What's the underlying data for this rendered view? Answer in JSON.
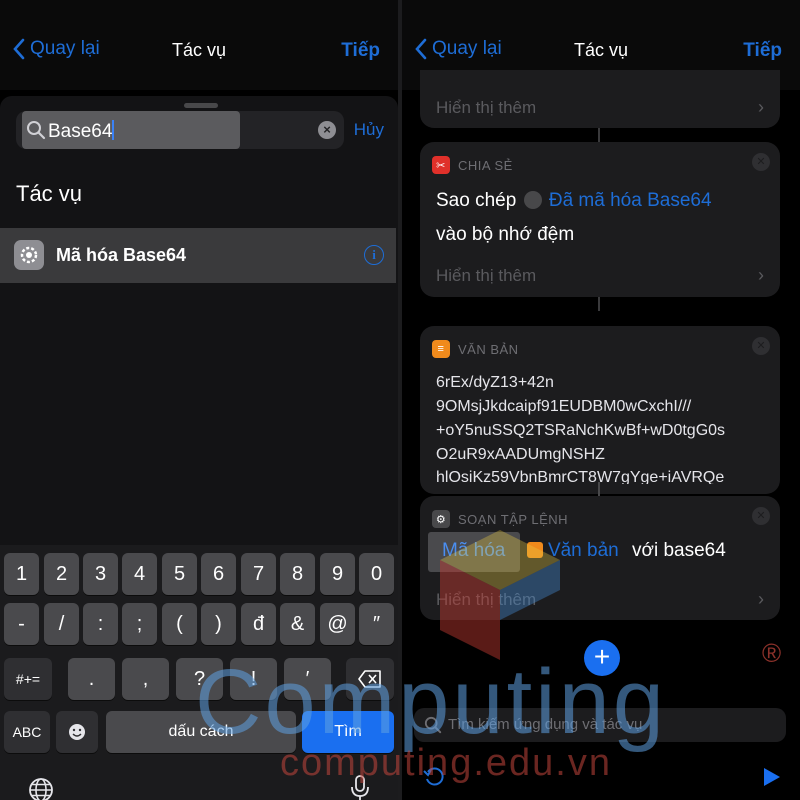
{
  "left": {
    "nav": {
      "back_label": "Quay lại",
      "title": "Tác vụ",
      "next_label": "Tiếp"
    },
    "search": {
      "query": "Base64",
      "cancel_label": "Hủy"
    },
    "section_title": "Tác vụ",
    "result": {
      "label": "Mã hóa Base64"
    },
    "keyboard": {
      "row1": [
        "1",
        "2",
        "3",
        "4",
        "5",
        "6",
        "7",
        "8",
        "9",
        "0"
      ],
      "row2": [
        "-",
        "/",
        ":",
        ";",
        "(",
        ")",
        "đ",
        "&",
        "@",
        "″"
      ],
      "row3_mode": "#+=",
      "row3": [
        ".",
        ",",
        "?",
        "!",
        "′"
      ],
      "abc_label": "ABC",
      "space_label": "dấu cách",
      "go_label": "Tìm"
    }
  },
  "right": {
    "nav": {
      "back_label": "Quay lại",
      "title": "Tác vụ",
      "next_label": "Tiếp"
    },
    "show_more_label": "Hiển thị thêm",
    "share_card": {
      "category": "CHIA SẺ",
      "verb": "Sao chép",
      "variable": "Đã mã hóa Base64",
      "tail": "vào bộ nhớ đệm"
    },
    "text_card": {
      "category": "VĂN BẢN",
      "lines": [
        "6rEx/dyZ13+42n",
        "9OMsjJkdcaipf91EUDBM0wCxchI///",
        "+oY5nuSSQ2TSRaNchKwBf+wD0tgG0s",
        "O2uR9xAADUmgNSHZ",
        "hlOsiKz59VbnBmrCT8W7gYge+iAVRQe"
      ]
    },
    "script_card": {
      "category": "SOẠN TẬP LỆNH",
      "action": "Mã hóa",
      "variable": "Văn bản",
      "tail": "với base64"
    },
    "add_label": "+",
    "bottom_search_placeholder": "Tìm kiếm ứng dụng và tác vụ"
  },
  "watermark": {
    "brand": "Computing",
    "url": "computing.edu.vn",
    "reg": "®"
  },
  "colors": {
    "accent": "#1e6dd6",
    "share_badge": "#e0302a",
    "text_badge": "#f08a1c",
    "script_badge": "#8e8e93"
  }
}
